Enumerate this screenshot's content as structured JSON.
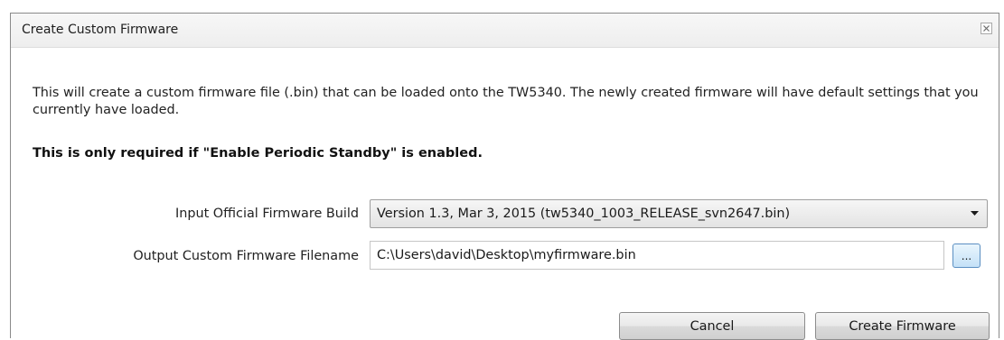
{
  "window": {
    "title": "Create Custom Firmware",
    "close_icon": "close-icon"
  },
  "content": {
    "description": "This will create a custom firmware file (.bin) that can be loaded onto the TW5340. The newly created firmware will have default settings that you currently have loaded.",
    "note": "This is only required if \"Enable Periodic Standby\" is enabled."
  },
  "form": {
    "input_label": "Input Official Firmware Build",
    "input_selected": "Version 1.3, Mar 3, 2015 (tw5340_1003_RELEASE_svn2647.bin)",
    "output_label": "Output Custom Firmware Filename",
    "output_value": "C:\\Users\\david\\Desktop\\myfirmware.bin",
    "browse_label": "..."
  },
  "buttons": {
    "cancel": "Cancel",
    "create": "Create Firmware"
  }
}
